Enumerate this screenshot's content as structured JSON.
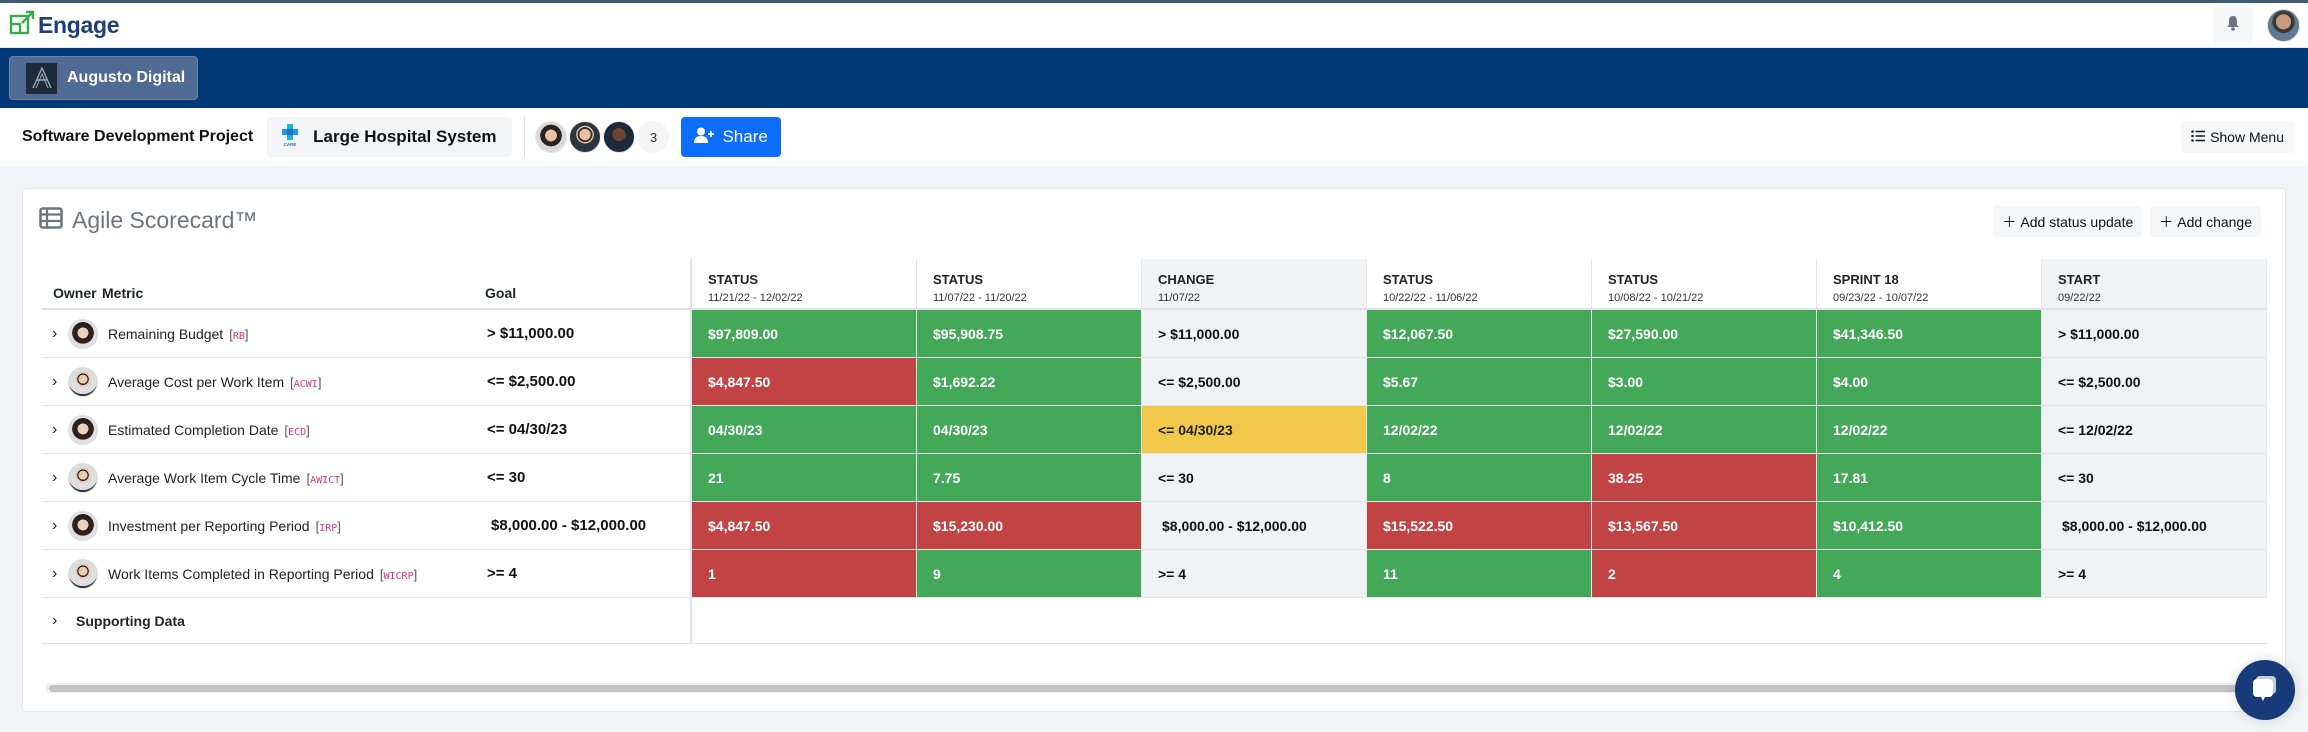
{
  "app": {
    "name": "Engage",
    "icons": {
      "logo": "engage-logo-icon",
      "notifications": "bell-icon",
      "user": "user-avatar"
    }
  },
  "org": {
    "name": "Augusto Digital"
  },
  "project": {
    "title": "Software Development Project",
    "client": "Large Hospital System",
    "team_count": "3",
    "share_label": "Share",
    "show_menu_label": "Show Menu"
  },
  "scorecard": {
    "title": "Agile Scorecard™",
    "actions": {
      "add_status_update": "Add status update",
      "add_change": "Add change"
    },
    "headers": {
      "owner": "Owner",
      "metric": "Metric",
      "goal": "Goal"
    },
    "columns": [
      {
        "title": "STATUS",
        "date": "11/21/22 - 12/02/22",
        "kind": "status"
      },
      {
        "title": "STATUS",
        "date": "11/07/22 - 11/20/22",
        "kind": "status"
      },
      {
        "title": "CHANGE",
        "date": "11/07/22",
        "kind": "change"
      },
      {
        "title": "STATUS",
        "date": "10/22/22 - 11/06/22",
        "kind": "status"
      },
      {
        "title": "STATUS",
        "date": "10/08/22 - 10/21/22",
        "kind": "status"
      },
      {
        "title": "SPRINT 18",
        "date": "09/23/22 - 10/07/22",
        "kind": "status"
      },
      {
        "title": "START",
        "date": "09/22/22",
        "kind": "start"
      }
    ],
    "rows": [
      {
        "owner": "female",
        "metric": "Remaining Budget",
        "code": "RB",
        "goal": "> $11,000.00",
        "cells": [
          {
            "v": "$97,809.00",
            "s": "green"
          },
          {
            "v": "$95,908.75",
            "s": "green"
          },
          {
            "v": "> $11,000.00",
            "s": "neutral"
          },
          {
            "v": "$12,067.50",
            "s": "green"
          },
          {
            "v": "$27,590.00",
            "s": "green"
          },
          {
            "v": "$41,346.50",
            "s": "green"
          },
          {
            "v": "> $11,000.00",
            "s": "neutral"
          }
        ]
      },
      {
        "owner": "male",
        "metric": "Average Cost per Work Item",
        "code": "ACWI",
        "goal": "<= $2,500.00",
        "cells": [
          {
            "v": "$4,847.50",
            "s": "red"
          },
          {
            "v": "$1,692.22",
            "s": "green"
          },
          {
            "v": "<= $2,500.00",
            "s": "neutral"
          },
          {
            "v": "$5.67",
            "s": "green"
          },
          {
            "v": "$3.00",
            "s": "green"
          },
          {
            "v": "$4.00",
            "s": "green"
          },
          {
            "v": "<= $2,500.00",
            "s": "neutral"
          }
        ]
      },
      {
        "owner": "female",
        "metric": "Estimated Completion Date",
        "code": "ECD",
        "goal": "<= 04/30/23",
        "cells": [
          {
            "v": "04/30/23",
            "s": "green"
          },
          {
            "v": "04/30/23",
            "s": "green"
          },
          {
            "v": "<= 04/30/23",
            "s": "yellow"
          },
          {
            "v": "12/02/22",
            "s": "green"
          },
          {
            "v": "12/02/22",
            "s": "green"
          },
          {
            "v": "12/02/22",
            "s": "green"
          },
          {
            "v": "<= 12/02/22",
            "s": "neutral"
          }
        ]
      },
      {
        "owner": "male",
        "metric": "Average Work Item Cycle Time",
        "code": "AWICT",
        "goal": "<= 30",
        "cells": [
          {
            "v": "21",
            "s": "green"
          },
          {
            "v": "7.75",
            "s": "green"
          },
          {
            "v": "<= 30",
            "s": "neutral"
          },
          {
            "v": "8",
            "s": "green"
          },
          {
            "v": "38.25",
            "s": "red"
          },
          {
            "v": "17.81",
            "s": "green"
          },
          {
            "v": "<= 30",
            "s": "neutral"
          }
        ]
      },
      {
        "owner": "female",
        "metric": "Investment per Reporting Period",
        "code": "IRP",
        "goal": "$8,000.00 - $12,000.00",
        "cells": [
          {
            "v": "$4,847.50",
            "s": "red"
          },
          {
            "v": "$15,230.00",
            "s": "red"
          },
          {
            "v": "$8,000.00 - $12,000.00",
            "s": "neutral"
          },
          {
            "v": "$15,522.50",
            "s": "red"
          },
          {
            "v": "$13,567.50",
            "s": "red"
          },
          {
            "v": "$10,412.50",
            "s": "green"
          },
          {
            "v": "$8,000.00 - $12,000.00",
            "s": "neutral"
          }
        ]
      },
      {
        "owner": "male",
        "metric": "Work Items Completed in Reporting Period",
        "code": "WICRP",
        "goal": ">= 4",
        "cells": [
          {
            "v": "1",
            "s": "red"
          },
          {
            "v": "9",
            "s": "green"
          },
          {
            "v": ">= 4",
            "s": "neutral"
          },
          {
            "v": "11",
            "s": "green"
          },
          {
            "v": "2",
            "s": "red"
          },
          {
            "v": "4",
            "s": "green"
          },
          {
            "v": ">= 4",
            "s": "neutral"
          }
        ]
      }
    ],
    "supporting_data_label": "Supporting Data",
    "status_colors": {
      "green": "#43a857",
      "red": "#c14343",
      "yellow": "#f2c84a",
      "neutral": "#f0f3f6"
    }
  }
}
